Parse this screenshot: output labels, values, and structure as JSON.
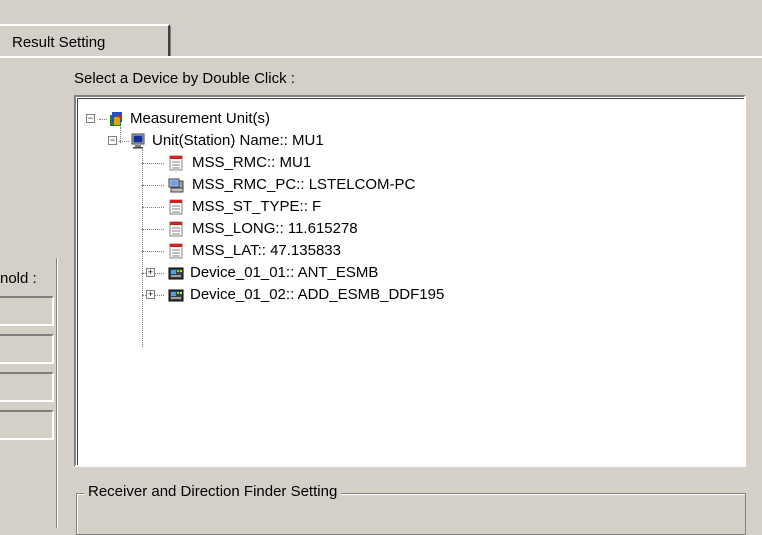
{
  "tab": {
    "label": "Result Setting"
  },
  "tree_section": {
    "label": "Select a Device by Double Click :"
  },
  "left_panel": {
    "label": "nold :"
  },
  "tree": {
    "root": {
      "label": "Measurement Unit(s)",
      "icon": "measurement-units-icon"
    },
    "station": {
      "label": "Unit(Station) Name:: MU1",
      "icon": "computer-monitor-icon"
    },
    "items": [
      {
        "label": "MSS_RMC:: MU1",
        "icon": "document-icon"
      },
      {
        "label": "MSS_RMC_PC:: LSTELCOM-PC",
        "icon": "pc-icon"
      },
      {
        "label": "MSS_ST_TYPE:: F",
        "icon": "document-icon"
      },
      {
        "label": "MSS_LONG:: 11.615278",
        "icon": "document-icon"
      },
      {
        "label": "MSS_LAT:: 47.135833",
        "icon": "document-icon"
      }
    ],
    "devices": [
      {
        "label": "Device_01_01:: ANT_ESMB",
        "icon": "device-icon"
      },
      {
        "label": "Device_01_02:: ADD_ESMB_DDF195",
        "icon": "device-icon"
      }
    ]
  },
  "group": {
    "title": "Receiver and Direction Finder Setting"
  }
}
